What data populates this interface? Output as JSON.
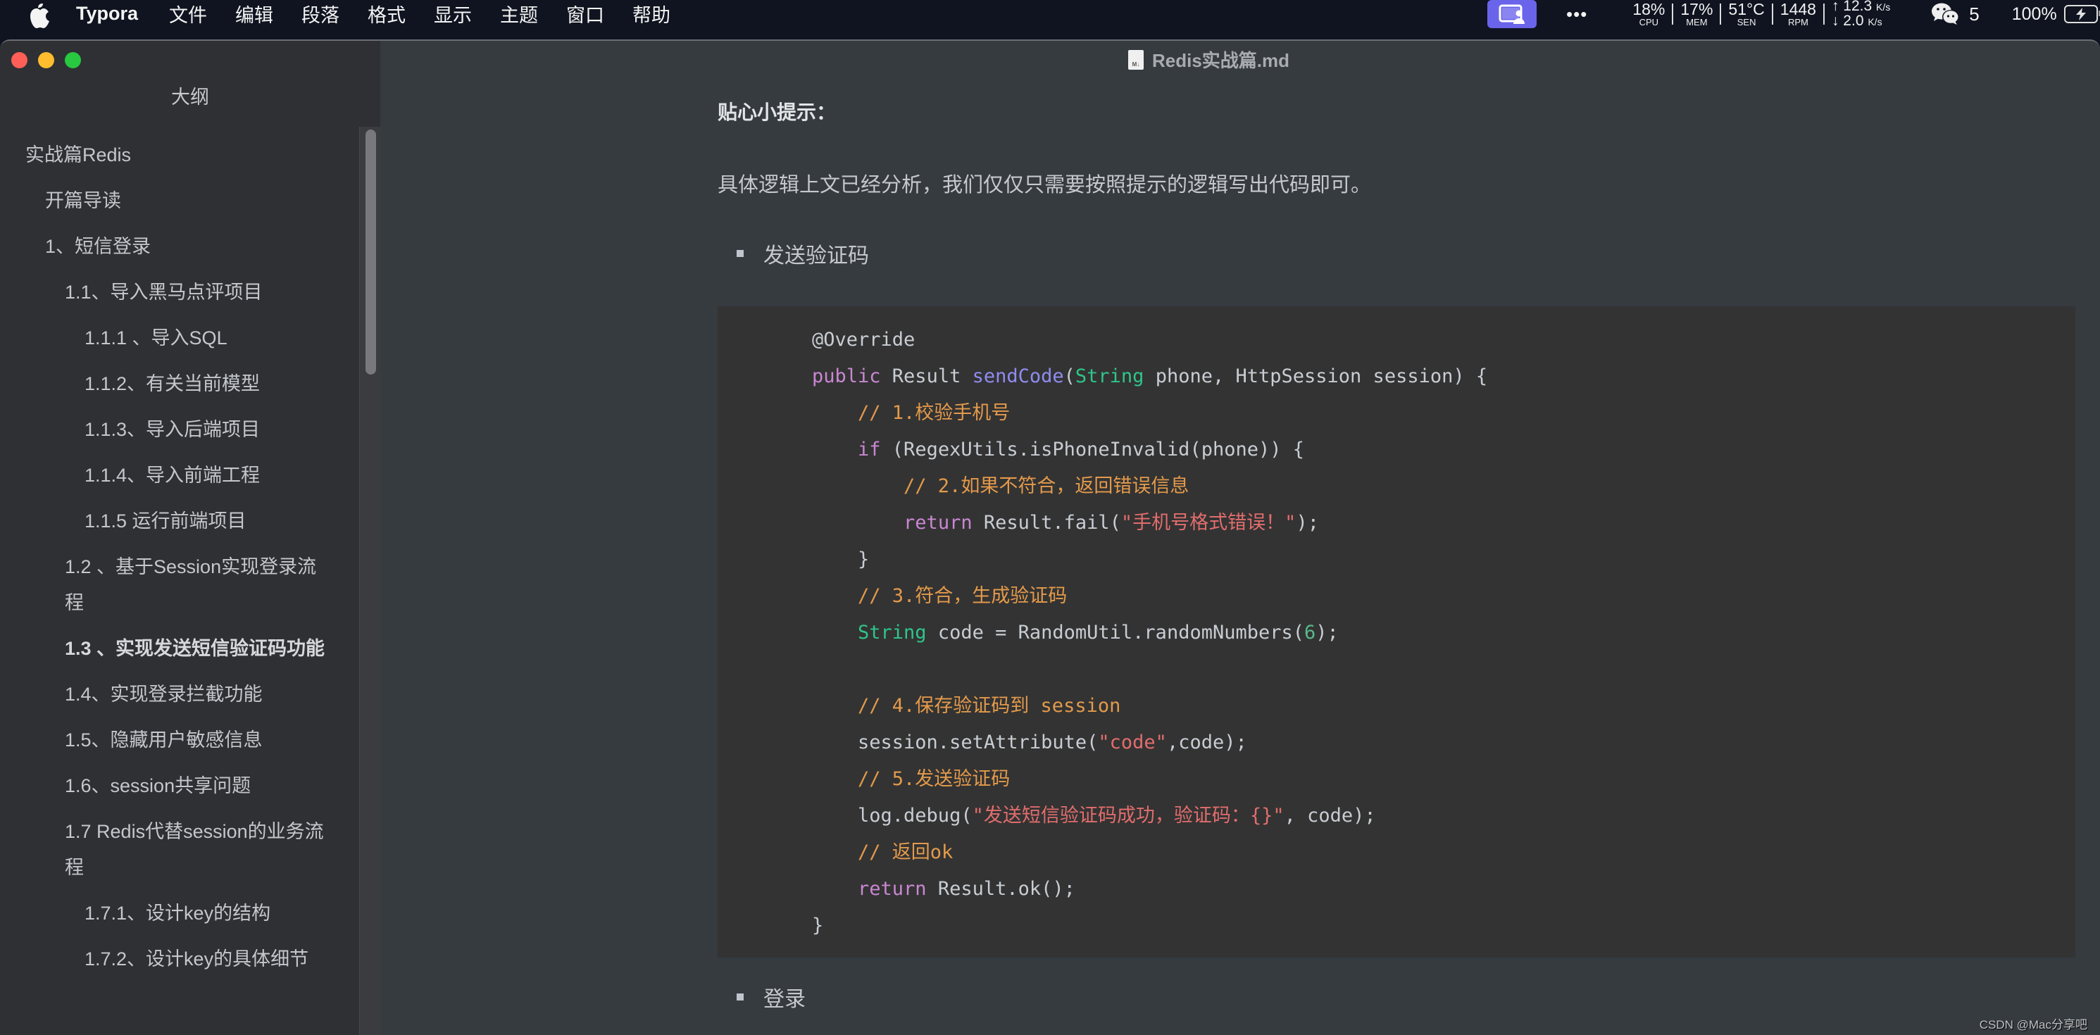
{
  "menubar": {
    "app_name": "Typora",
    "menus": [
      "文件",
      "编辑",
      "段落",
      "格式",
      "显示",
      "主题",
      "窗口",
      "帮助"
    ],
    "status": {
      "cast_icon": "screen-share-icon",
      "more_icon": "ellipsis-icon",
      "cpu": {
        "value": "18%",
        "label": "CPU"
      },
      "mem": {
        "value": "17%",
        "label": "MEM"
      },
      "sen": {
        "value": "51°C",
        "label": "SEN"
      },
      "rpm": {
        "value": "1448",
        "label": "RPM"
      },
      "net_up": "↑ 12.3",
      "net_up_unit": "K/s",
      "net_down": "↓ 2.0",
      "net_down_unit": "K/s",
      "wechat_count": "5",
      "battery": "100%"
    }
  },
  "window": {
    "title": "Redis实战篇.md",
    "colors": {
      "close": "#ff5f57",
      "minimize": "#febc2e",
      "zoom": "#28c840"
    }
  },
  "sidebar": {
    "title": "大纲",
    "items": [
      {
        "label": "实战篇Redis",
        "level": 1
      },
      {
        "label": "开篇导读",
        "level": 2
      },
      {
        "label": "1、短信登录",
        "level": 2
      },
      {
        "label": "1.1、导入黑马点评项目",
        "level": 3
      },
      {
        "label": "1.1.1 、导入SQL",
        "level": 4
      },
      {
        "label": "1.1.2、有关当前模型",
        "level": 4
      },
      {
        "label": "1.1.3、导入后端项目",
        "level": 4
      },
      {
        "label": "1.1.4、导入前端工程",
        "level": 4
      },
      {
        "label": "1.1.5 运行前端项目",
        "level": 4
      },
      {
        "label": "1.2 、基于Session实现登录流程",
        "level": 3
      },
      {
        "label": "1.3 、实现发送短信验证码功能",
        "level": 3,
        "active": true
      },
      {
        "label": "1.4、实现登录拦截功能",
        "level": 3
      },
      {
        "label": "1.5、隐藏用户敏感信息",
        "level": 3
      },
      {
        "label": "1.6、session共享问题",
        "level": 3
      },
      {
        "label": "1.7 Redis代替session的业务流程",
        "level": 3
      },
      {
        "label": "1.7.1、设计key的结构",
        "level": 4
      },
      {
        "label": "1.7.2、设计key的具体细节",
        "level": 4
      }
    ]
  },
  "content": {
    "tip_heading": "贴心小提示：",
    "paragraph": "具体逻辑上文已经分析，我们仅仅只需要按照提示的逻辑写出代码即可。",
    "bullet1": "发送验证码",
    "bullet2": "登录",
    "code_language": "java",
    "code_lines": [
      [
        {
          "t": "@Override",
          "c": ""
        }
      ],
      [
        {
          "t": "public ",
          "c": "kw"
        },
        {
          "t": "Result ",
          "c": ""
        },
        {
          "t": "sendCode",
          "c": "fn"
        },
        {
          "t": "(",
          "c": ""
        },
        {
          "t": "String",
          "c": "ty"
        },
        {
          "t": " phone, HttpSession session) {",
          "c": ""
        }
      ],
      [
        {
          "t": "    // 1.校验手机号",
          "c": "cm"
        }
      ],
      [
        {
          "t": "    ",
          "c": ""
        },
        {
          "t": "if",
          "c": "kw"
        },
        {
          "t": " (RegexUtils.isPhoneInvalid(phone)) {",
          "c": ""
        }
      ],
      [
        {
          "t": "        // 2.如果不符合，返回错误信息",
          "c": "cm"
        }
      ],
      [
        {
          "t": "        ",
          "c": ""
        },
        {
          "t": "return",
          "c": "kw"
        },
        {
          "t": " Result.fail(",
          "c": ""
        },
        {
          "t": "\"手机号格式错误！\"",
          "c": "st"
        },
        {
          "t": ");",
          "c": ""
        }
      ],
      [
        {
          "t": "    }",
          "c": ""
        }
      ],
      [
        {
          "t": "    // 3.符合，生成验证码",
          "c": "cm"
        }
      ],
      [
        {
          "t": "    ",
          "c": ""
        },
        {
          "t": "String",
          "c": "ty"
        },
        {
          "t": " code = RandomUtil.randomNumbers(",
          "c": ""
        },
        {
          "t": "6",
          "c": "nu"
        },
        {
          "t": ");",
          "c": ""
        }
      ],
      [
        {
          "t": "",
          "c": ""
        }
      ],
      [
        {
          "t": "    // 4.保存验证码到 session",
          "c": "cm"
        }
      ],
      [
        {
          "t": "    session.setAttribute(",
          "c": ""
        },
        {
          "t": "\"code\"",
          "c": "st"
        },
        {
          "t": ",code);",
          "c": ""
        }
      ],
      [
        {
          "t": "    // 5.发送验证码",
          "c": "cm"
        }
      ],
      [
        {
          "t": "    log.debug(",
          "c": ""
        },
        {
          "t": "\"发送短信验证码成功，验证码：{}\"",
          "c": "st"
        },
        {
          "t": ", code);",
          "c": ""
        }
      ],
      [
        {
          "t": "    // 返回ok",
          "c": "cm"
        }
      ],
      [
        {
          "t": "    ",
          "c": ""
        },
        {
          "t": "return",
          "c": "kw"
        },
        {
          "t": " Result.ok();",
          "c": ""
        }
      ],
      [
        {
          "t": "}",
          "c": ""
        }
      ]
    ]
  },
  "watermark": "CSDN @Mac分享吧"
}
